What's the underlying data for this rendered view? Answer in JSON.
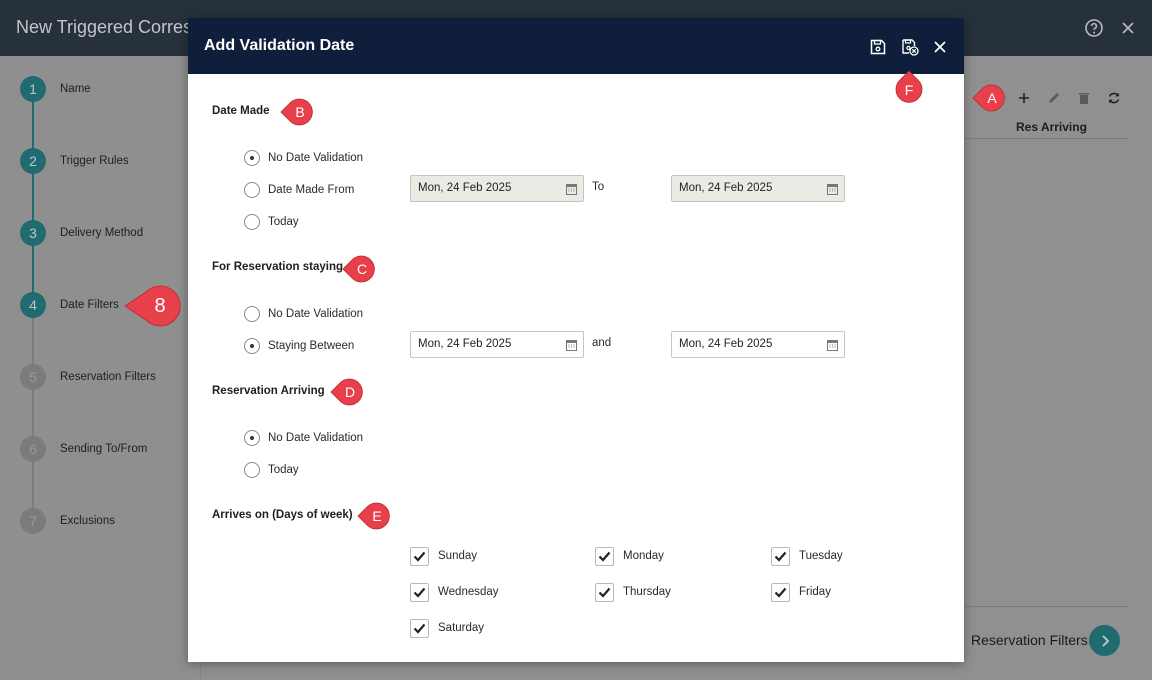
{
  "app": {
    "title": "New Triggered Corresp",
    "steps": [
      {
        "num": "1",
        "label": "Name"
      },
      {
        "num": "2",
        "label": "Trigger Rules"
      },
      {
        "num": "3",
        "label": "Delivery Method"
      },
      {
        "num": "4",
        "label": "Date Filters"
      },
      {
        "num": "5",
        "label": "Reservation Filters"
      },
      {
        "num": "6",
        "label": "Sending To/From"
      },
      {
        "num": "7",
        "label": "Exclusions"
      }
    ],
    "grid_column_header": "Res Arriving",
    "next_step_label": "Reservation Filters"
  },
  "modal": {
    "title": "Add Validation Date",
    "date_made": {
      "title": "Date Made",
      "options": [
        "No Date Validation",
        "Date Made From",
        "Today"
      ],
      "selected": "No Date Validation",
      "from_date": "Mon, 24 Feb 2025",
      "connector": "To",
      "to_date": "Mon, 24 Feb 2025"
    },
    "staying": {
      "title": "For Reservation staying",
      "options": [
        "No Date Validation",
        "Staying Between"
      ],
      "selected": "Staying Between",
      "from_date": "Mon, 24 Feb 2025",
      "connector": "and",
      "to_date": "Mon, 24 Feb 2025"
    },
    "arriving": {
      "title": "Reservation Arriving",
      "options": [
        "No Date Validation",
        "Today"
      ],
      "selected": "No Date Validation"
    },
    "days": {
      "title": "Arrives on (Days of week)",
      "items": [
        {
          "label": "Sunday",
          "checked": true
        },
        {
          "label": "Monday",
          "checked": true
        },
        {
          "label": "Tuesday",
          "checked": true
        },
        {
          "label": "Wednesday",
          "checked": true
        },
        {
          "label": "Thursday",
          "checked": true
        },
        {
          "label": "Friday",
          "checked": true
        },
        {
          "label": "Saturday",
          "checked": true
        }
      ]
    }
  },
  "callouts": {
    "a": "A",
    "b": "B",
    "c": "C",
    "d": "D",
    "e": "E",
    "f": "F",
    "step": "8",
    "color": "#e8404a"
  },
  "colors": {
    "modal_header": "#0e1e3b",
    "app_header": "#27313b",
    "step_teal": "#206b6f",
    "disabled_field": "#ebebe6"
  }
}
